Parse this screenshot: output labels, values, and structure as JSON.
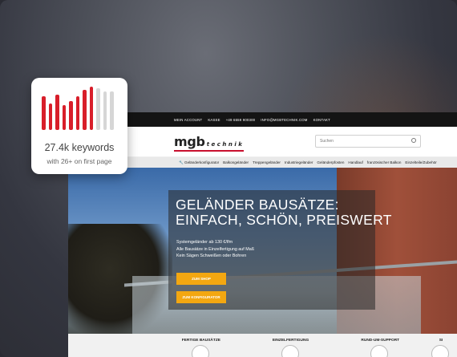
{
  "topbar": {
    "links": [
      "MEIN ACCOUNT",
      "KASSE",
      "+49 6559 900300",
      "INFO@MGBTECHNIK.COM",
      "KONTAKT"
    ]
  },
  "header": {
    "logo_main": "mgb",
    "logo_sub": "technik",
    "search_placeholder": "Suchen"
  },
  "nav": {
    "items": [
      "Geländerkonfigurator",
      "Balkongeländer",
      "Treppengeländer",
      "Industriegeländer",
      "Geländerpfosten",
      "Handlauf",
      "französischer Balkon",
      "Einzelteile/Zubehör"
    ]
  },
  "hero": {
    "title_line1": "GELÄNDER BAUSÄTZE:",
    "title_line2": "EINFACH, SCHÖN, PREISWERT",
    "text_line1": "Systemgeländer ab 130 €/lfm",
    "text_line2": "Alle Bausätze in Einzelfertigung auf Maß",
    "text_line3": "Kein Sägen Schweißen oder Bohren",
    "btn_shop": "ZUM SHOP",
    "btn_config": "ZUM KONFIGURATOR"
  },
  "features": [
    "FERTIGE BAUSÄTZE",
    "EINZELFERTIGUNG",
    "RUND-UM-SUPPORT",
    "SI"
  ],
  "card": {
    "keywords": "27.4k keywords",
    "subtitle": "with 26+ on first page",
    "colors": {
      "red": "#d81e2a",
      "gray": "#d6d6d6"
    },
    "bars": [
      {
        "level": 0.78,
        "status": "red"
      },
      {
        "level": 0.62,
        "status": "red"
      },
      {
        "level": 0.82,
        "status": "red"
      },
      {
        "level": 0.58,
        "status": "red"
      },
      {
        "level": 0.66,
        "status": "red"
      },
      {
        "level": 0.78,
        "status": "red"
      },
      {
        "level": 0.92,
        "status": "red"
      },
      {
        "level": 1.0,
        "status": "red"
      },
      {
        "level": 0.96,
        "status": "gray"
      },
      {
        "level": 0.88,
        "status": "gray"
      },
      {
        "level": 0.88,
        "status": "gray"
      }
    ]
  }
}
